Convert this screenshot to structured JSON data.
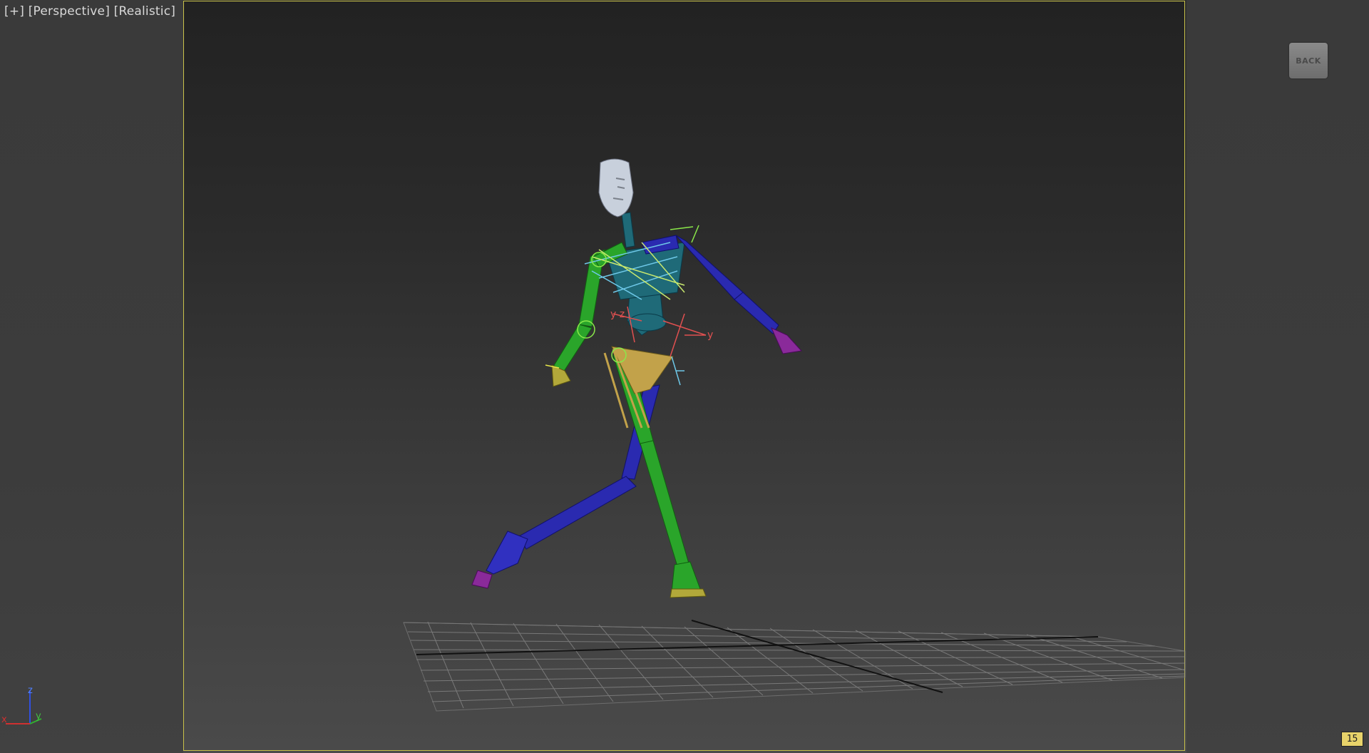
{
  "viewport": {
    "plus_label": "[+]",
    "view_label": "[Perspective]",
    "shading_label": "[Realistic]"
  },
  "viewcube": {
    "label": "BACK"
  },
  "axis_gizmo": {
    "z": "z",
    "y": "y",
    "x": "x"
  },
  "frame_badge": "15",
  "colors": {
    "safe_frame": "#c9c24a",
    "left_limb": "#2aa52a",
    "right_limb": "#2a2ab0",
    "pelvis": "#c2a24a",
    "spine": "#1f6a78",
    "head": "#c8d0dc",
    "grid": "#8a8a8a"
  },
  "icons": {
    "viewcube": "viewcube-icon",
    "axis_tripod": "axis-tripod-icon"
  }
}
